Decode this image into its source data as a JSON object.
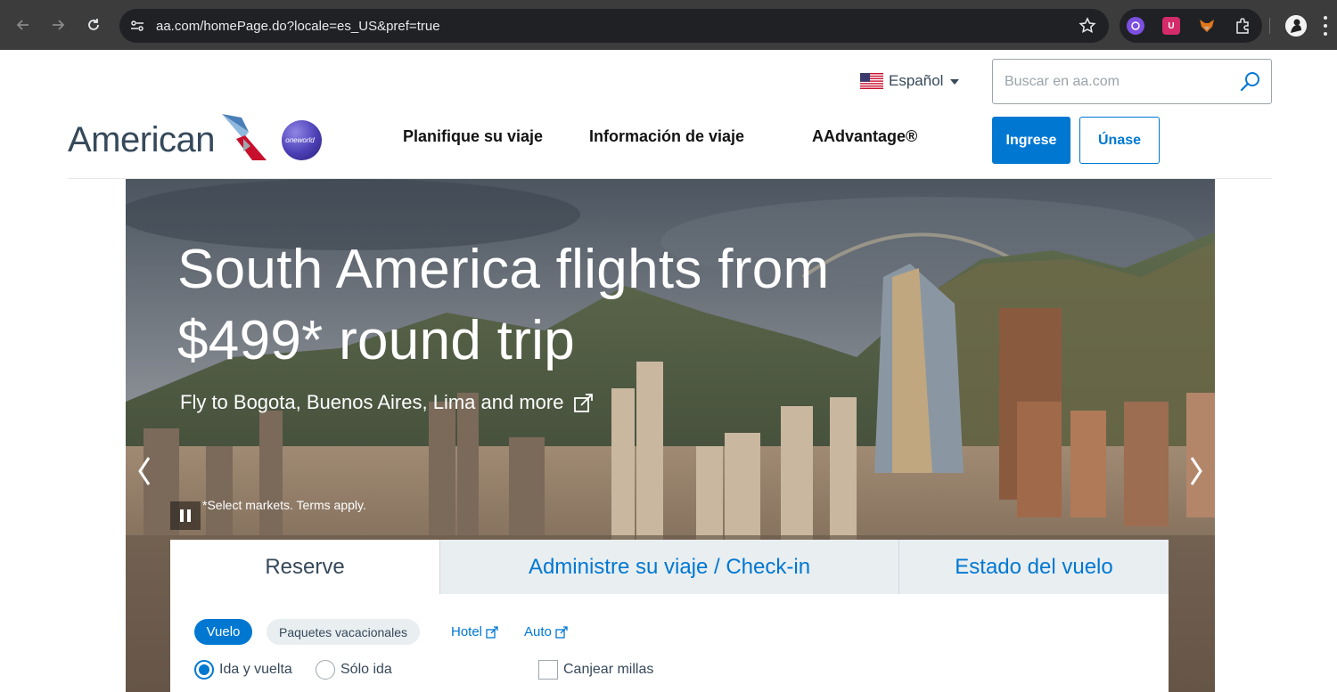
{
  "browser": {
    "url": "aa.com/homePage.do?locale=es_US&pref=true",
    "icons": {
      "back": "back-arrow-icon",
      "forward": "forward-arrow-icon",
      "reload": "reload-icon",
      "site_info": "site-info-icon",
      "bookmark": "star-icon",
      "extensions": "puzzle-icon",
      "menu": "kebab-menu-icon"
    }
  },
  "header": {
    "language_label": "Español",
    "search_placeholder": "Buscar en aa.com",
    "logo_text": "American",
    "alliance_text": "oneworld",
    "nav": [
      {
        "label": "Planifique su viaje"
      },
      {
        "label": "Información de viaje"
      },
      {
        "label": "AAdvantage®"
      }
    ],
    "login_label": "Ingrese",
    "join_label": "Únase"
  },
  "hero": {
    "headline": "South America flights from $499* round trip",
    "subhead": "Fly to Bogota, Buenos Aires, Lima and more",
    "terms": "*Select markets. Terms apply."
  },
  "booking": {
    "tabs": [
      {
        "label": "Reserve",
        "active": true
      },
      {
        "label": "Administre su viaje / Check-in",
        "active": false
      },
      {
        "label": "Estado del vuelo",
        "active": false
      }
    ],
    "products": [
      {
        "label": "Vuelo",
        "selected": true
      },
      {
        "label": "Paquetes vacacionales",
        "selected": false
      }
    ],
    "external_links": [
      {
        "label": "Hotel"
      },
      {
        "label": "Auto"
      }
    ],
    "trip_types": [
      {
        "label": "Ida y vuelta",
        "checked": true
      },
      {
        "label": "Sólo ida",
        "checked": false
      }
    ],
    "redeem_miles_label": "Canjear millas"
  },
  "colors": {
    "brand_blue": "#0078d2",
    "text_dark": "#36495a",
    "chrome_bg": "#3c3c3c",
    "tab_inactive_bg": "#e9eef1"
  }
}
